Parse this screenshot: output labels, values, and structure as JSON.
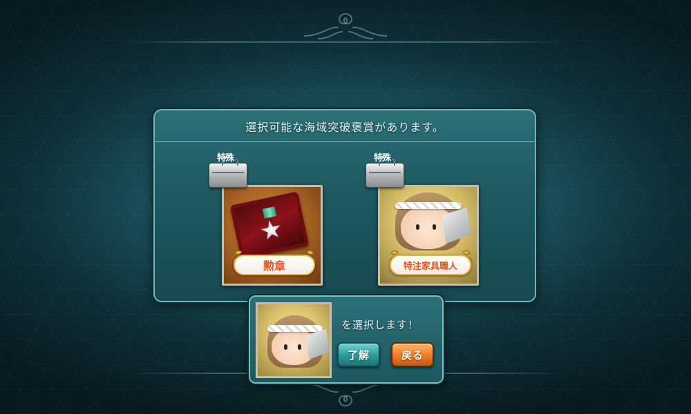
{
  "dialog": {
    "title": "選択可能な海域突破褒賞があります。"
  },
  "rewards": [
    {
      "tag": "特殊",
      "name": "勲章",
      "icon": "medal-case"
    },
    {
      "tag": "特殊",
      "name": "特注家具職人",
      "icon": "furniture-craftsman"
    }
  ],
  "confirm": {
    "message": "を選択します！",
    "ok_label": "了解",
    "back_label": "戻る",
    "selected_icon": "furniture-craftsman"
  },
  "colors": {
    "panel": "#1f5a62",
    "panel_border": "#6fb7bd",
    "ok_button": "#2a9a9c",
    "back_button": "#ec7a25",
    "name_text": "#e0531b"
  }
}
